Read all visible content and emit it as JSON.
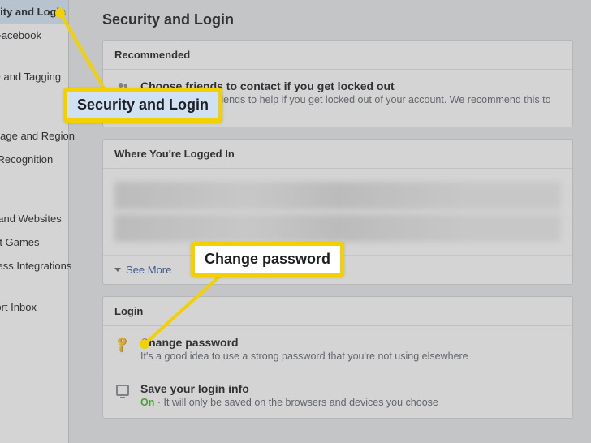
{
  "sidebar": {
    "items": [
      {
        "label": "Security and Login",
        "active": true
      },
      {
        "label": "Your Facebook"
      },
      {
        "label": ""
      },
      {
        "label": ""
      },
      {
        "label": "Profile and Tagging"
      },
      {
        "label": ""
      },
      {
        "label": ""
      },
      {
        "label": "Language and Region"
      },
      {
        "label": "Face Recognition"
      },
      {
        "label": ""
      },
      {
        "label": ""
      },
      {
        "label": "Apps and Websites"
      },
      {
        "label": "Instant Games"
      },
      {
        "label": "Business Integrations"
      },
      {
        "label": ""
      },
      {
        "label": "Support Inbox"
      }
    ]
  },
  "page": {
    "title": "Security and Login"
  },
  "recommended": {
    "header": "Recommended",
    "item": {
      "title": "Choose friends to contact if you get locked out",
      "sub": "Nominate 3 to 5 friends to help if you get locked out of your account. We recommend this to everyone."
    }
  },
  "logged_in": {
    "header": "Where You're Logged In",
    "see_more": "See More"
  },
  "login": {
    "header": "Login",
    "change_pw": {
      "title": "Change password",
      "sub": "It's a good idea to use a strong password that you're not using elsewhere"
    },
    "save_info": {
      "title": "Save your login info",
      "on_label": "On",
      "sub": " · It will only be saved on the browsers and devices you choose"
    }
  },
  "callouts": {
    "c1": "Security and Login",
    "c2": "Change password"
  }
}
